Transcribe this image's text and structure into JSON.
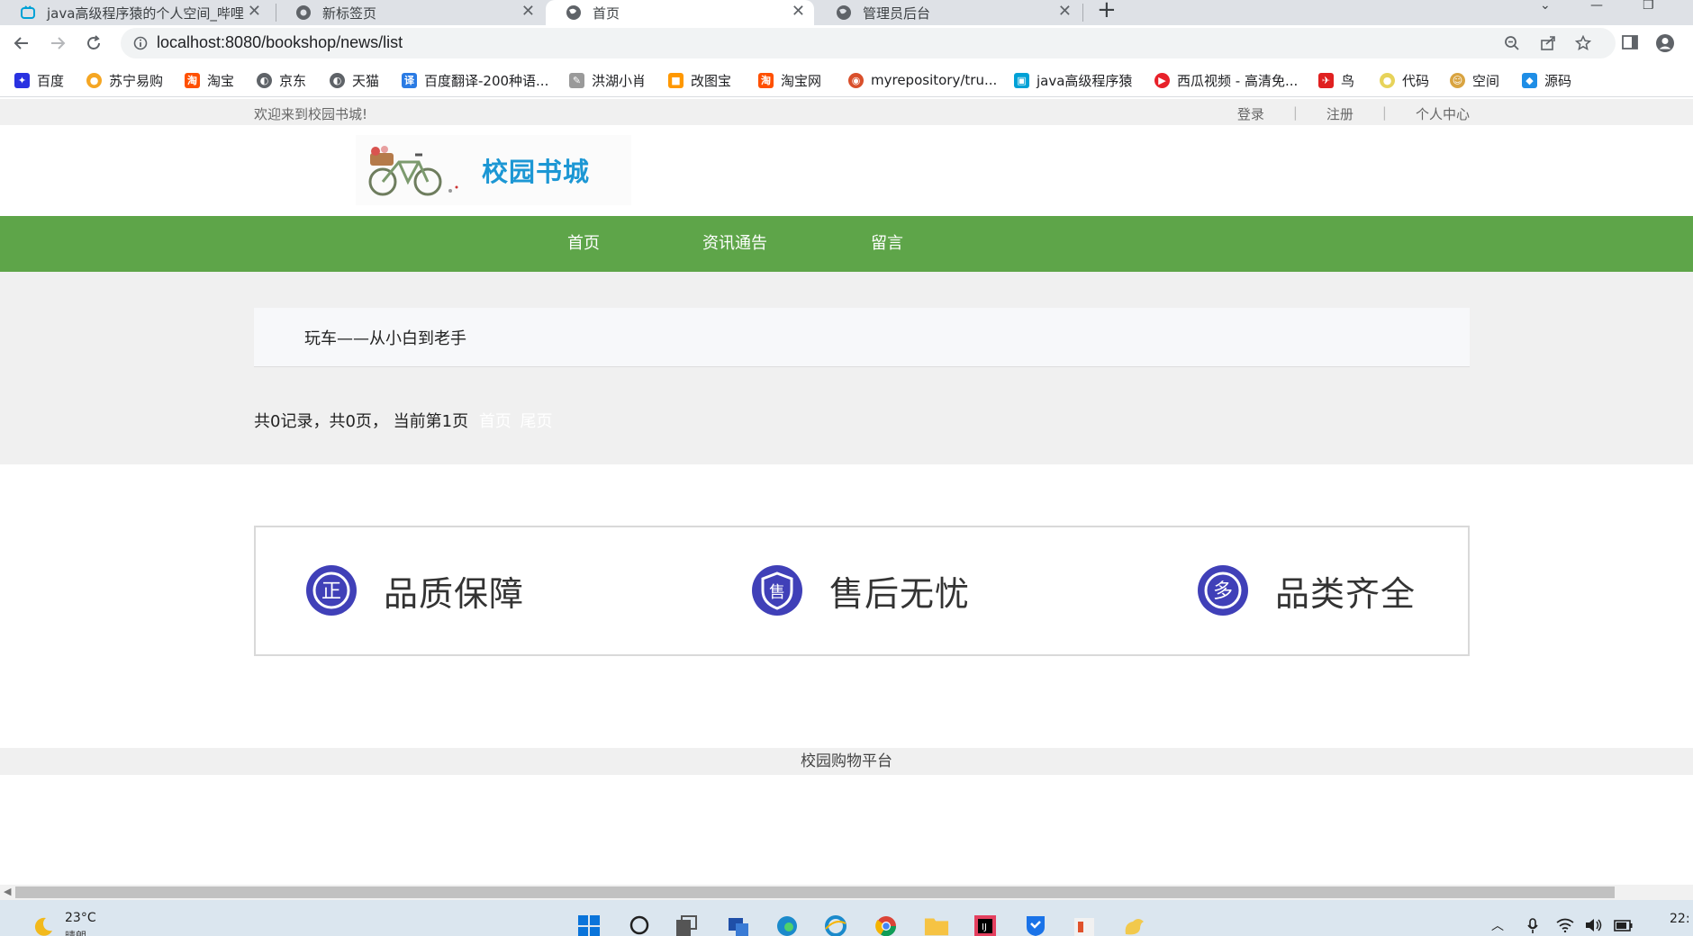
{
  "browser": {
    "tabs": [
      {
        "title": "java高级程序猿的个人空间_哔哩",
        "active": false
      },
      {
        "title": "新标签页",
        "active": false
      },
      {
        "title": "首页",
        "active": true
      },
      {
        "title": "管理员后台",
        "active": false
      }
    ],
    "new_tab": "+",
    "url": "localhost:8080/bookshop/news/list",
    "bookmarks": [
      {
        "label": "百度",
        "icon": "baidu-icon",
        "color": "#2932e1"
      },
      {
        "label": "苏宁易购",
        "icon": "suning-icon",
        "color": "#f5a623"
      },
      {
        "label": "淘宝",
        "icon": "taobao-icon",
        "color": "#ff5000"
      },
      {
        "label": "京东",
        "icon": "globe-icon",
        "color": "#5f6368"
      },
      {
        "label": "天猫",
        "icon": "globe-icon",
        "color": "#5f6368"
      },
      {
        "label": "百度翻译-200种语...",
        "icon": "fanyi-icon",
        "color": "#2a7be4"
      },
      {
        "label": "洪湖小肖",
        "icon": "feather-icon",
        "color": "#7b7b7b"
      },
      {
        "label": "改图宝",
        "icon": "gaitubao-icon",
        "color": "#ff9800"
      },
      {
        "label": "淘宝网",
        "icon": "taobao-icon",
        "color": "#ff5000"
      },
      {
        "label": "myrepository/tru...",
        "icon": "repo-icon",
        "color": "#d94f2b"
      },
      {
        "label": "java高级程序猿",
        "icon": "bilibili-icon",
        "color": "#00a1d6"
      },
      {
        "label": "西瓜视频 - 高清免...",
        "icon": "xigua-icon",
        "color": "#e8212a"
      },
      {
        "label": "鸟",
        "icon": "bird-icon",
        "color": "#e02020"
      },
      {
        "label": "代码",
        "icon": "code-icon",
        "color": "#e7d35a"
      },
      {
        "label": "空间",
        "icon": "space-icon",
        "color": "#d9a441"
      },
      {
        "label": "源码",
        "icon": "source-icon",
        "color": "#1f8ee6"
      }
    ]
  },
  "site": {
    "welcome": "欢迎来到校园书城!",
    "top_links": {
      "login": "登录",
      "sep": "|",
      "register": "注册",
      "profile": "个人中心"
    },
    "logo_text": "校园书城",
    "nav": [
      "首页",
      "资讯通告",
      "留言"
    ],
    "news": [
      {
        "title": "玩车——从小白到老手"
      }
    ],
    "pager": {
      "summary": "共0记录，共0页， 当前第1页",
      "first": "首页",
      "last": "尾页"
    },
    "features": [
      {
        "label": "品质保障",
        "glyph": "正",
        "icon": "quality-badge-icon"
      },
      {
        "label": "售后无忧",
        "glyph": "售",
        "icon": "aftersale-shield-icon"
      },
      {
        "label": "品类齐全",
        "glyph": "多",
        "icon": "variety-badge-icon"
      }
    ],
    "footer": "校园购物平台"
  },
  "taskbar": {
    "temp": "23°C",
    "weather": "晴朗",
    "clock": "22:"
  },
  "colors": {
    "nav_green": "#5ea549",
    "feature_blue": "#4040b8",
    "logo_blue": "#1c97d4"
  }
}
